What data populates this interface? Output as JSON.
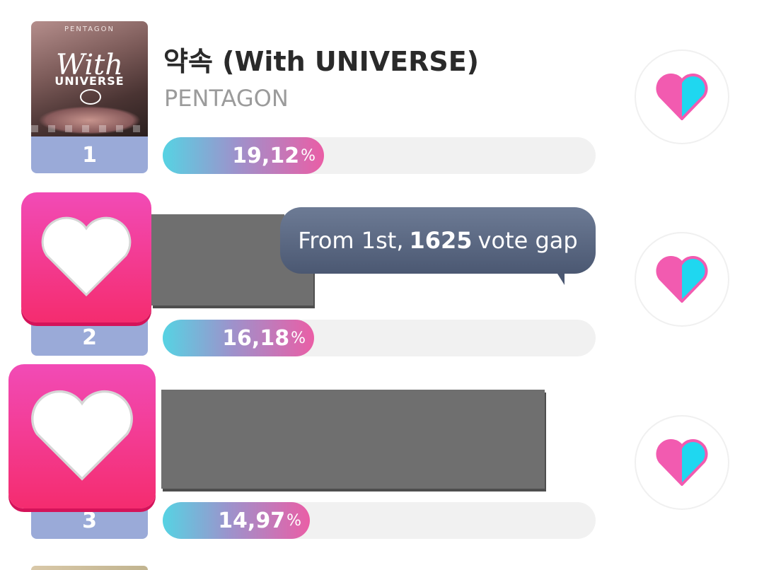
{
  "items": [
    {
      "rank": "1",
      "title": "약속 (With UNIVERSE)",
      "artist": "PENTAGON",
      "cover": {
        "brand": "PENTAGON",
        "script": "With",
        "subtitle": "UNIVERSE"
      },
      "percent_value": "19,12",
      "percent_sign": "%",
      "percent": 19.12
    },
    {
      "rank": "2",
      "percent_value": "16,18",
      "percent_sign": "%",
      "percent": 16.18,
      "gap_tooltip": {
        "prefix": "From 1st,",
        "gap": "1625",
        "suffix": "vote gap"
      }
    },
    {
      "rank": "3",
      "percent_value": "14,97",
      "percent_sign": "%",
      "percent": 14.97
    }
  ],
  "icons": {
    "vote": "heart-icon",
    "tile": "heart-icon"
  },
  "colors": {
    "rank_badge": "#9aaad8",
    "bar_gradient_start": "#56d3e3",
    "bar_gradient_end": "#ea5ea6",
    "heart_pink": "#f25bb0",
    "heart_cyan": "#1fd7f0",
    "tile_pink": "#f42c6f",
    "tooltip_bg": "#55627c"
  }
}
